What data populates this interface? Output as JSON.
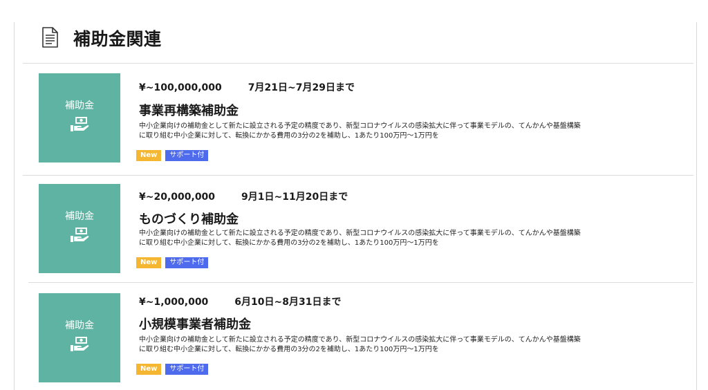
{
  "header": {
    "title": "補助金関連",
    "icon": "document-icon"
  },
  "colors": {
    "thumb_bg": "#5fb3a2",
    "tag_new": "#f5b731",
    "tag_support": "#4f6bed"
  },
  "items": [
    {
      "thumb_label": "補助金",
      "thumb_icon": "money-hand-icon",
      "amount": "¥~100,000,000",
      "period": "7月21日~7月29日まで",
      "title": "事業再構築補助金",
      "desc_line1": "中小企業向けの補助金として新たに設立される予定の精度であり、新型コロナウイルスの感染拡大に伴って事業モデルの、てんかんや基盤構築",
      "desc_line2": "に取り組む中小企業に対して、転換にかかる費用の3分の2を補助し、1あたり100万円〜1万円を",
      "tag_new": "New",
      "tag_support": "サポート付"
    },
    {
      "thumb_label": "補助金",
      "thumb_icon": "money-hand-icon",
      "amount": "¥~20,000,000",
      "period": "9月1日~11月20日まで",
      "title": "ものづくり補助金",
      "desc_line1": "中小企業向けの補助金として新たに設立される予定の精度であり、新型コロナウイルスの感染拡大に伴って事業モデルの、てんかんや基盤構築",
      "desc_line2": "に取り組む中小企業に対して、転換にかかる費用の3分の2を補助し、1あたり100万円〜1万円を",
      "tag_new": "New",
      "tag_support": "サポート付"
    },
    {
      "thumb_label": "補助金",
      "thumb_icon": "money-hand-icon",
      "amount": "¥~1,000,000",
      "period": "6月10日~8月31日まで",
      "title": "小規模事業者補助金",
      "desc_line1": "中小企業向けの補助金として新たに設立される予定の精度であり、新型コロナウイルスの感染拡大に伴って事業モデルの、てんかんや基盤構築",
      "desc_line2": "に取り組む中小企業に対して、転換にかかる費用の3分の2を補助し、1あたり100万円〜1万円を",
      "tag_new": "New",
      "tag_support": "サポート付"
    }
  ]
}
